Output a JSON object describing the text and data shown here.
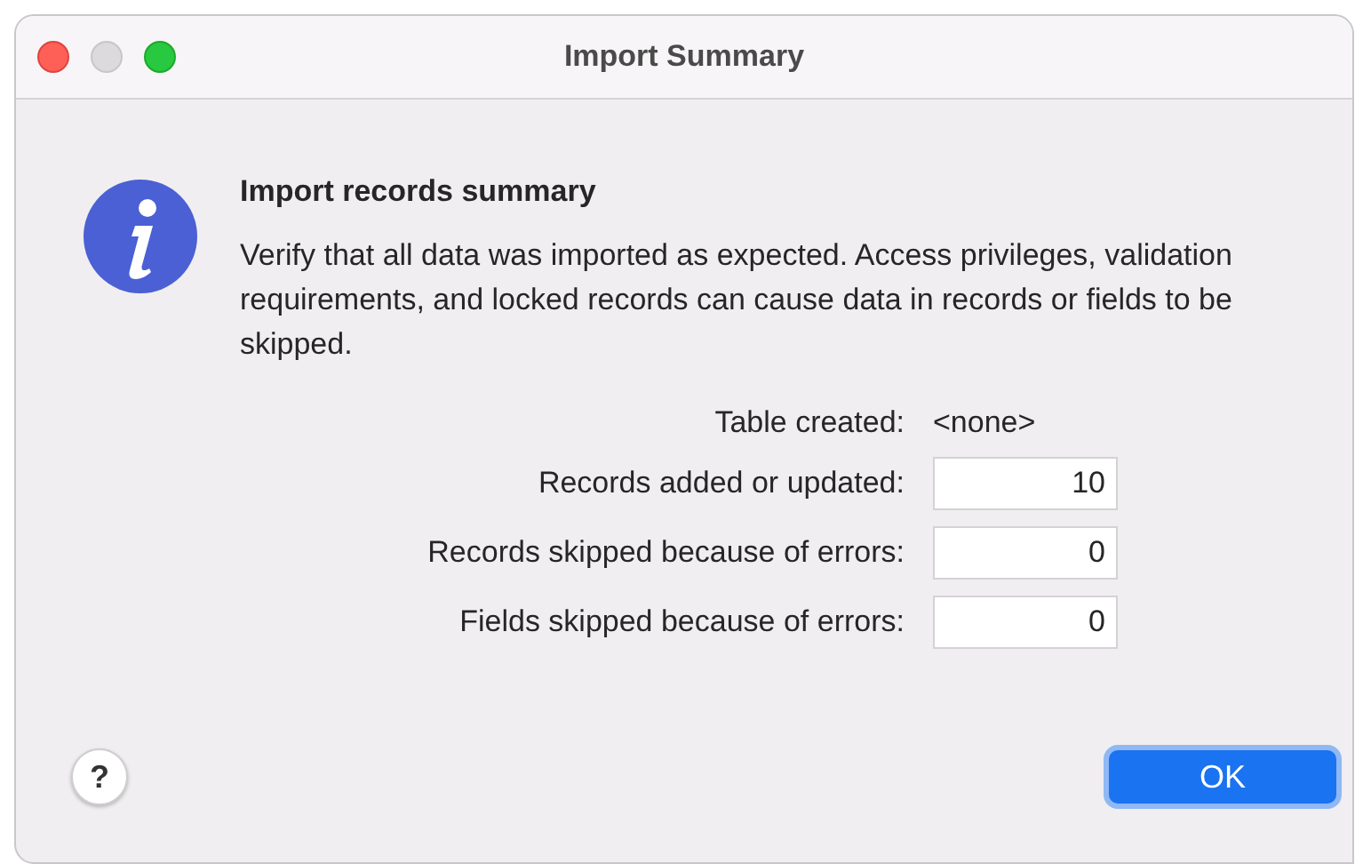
{
  "window": {
    "title": "Import Summary"
  },
  "heading": "Import records summary",
  "message": "Verify that all data was imported as expected. Access privileges, validation requirements, and locked records can cause data in records or fields to be skipped.",
  "rows": [
    {
      "kind": "text",
      "label": "Table created:",
      "value": "<none>"
    },
    {
      "kind": "field",
      "label": "Records added or updated:",
      "value": "10"
    },
    {
      "kind": "field",
      "label": "Records skipped because of errors:",
      "value": "0"
    },
    {
      "kind": "field",
      "label": "Fields skipped because of errors:",
      "value": "0"
    }
  ],
  "help_button": "?",
  "buttons": [
    {
      "label": "OK",
      "default": true
    }
  ]
}
